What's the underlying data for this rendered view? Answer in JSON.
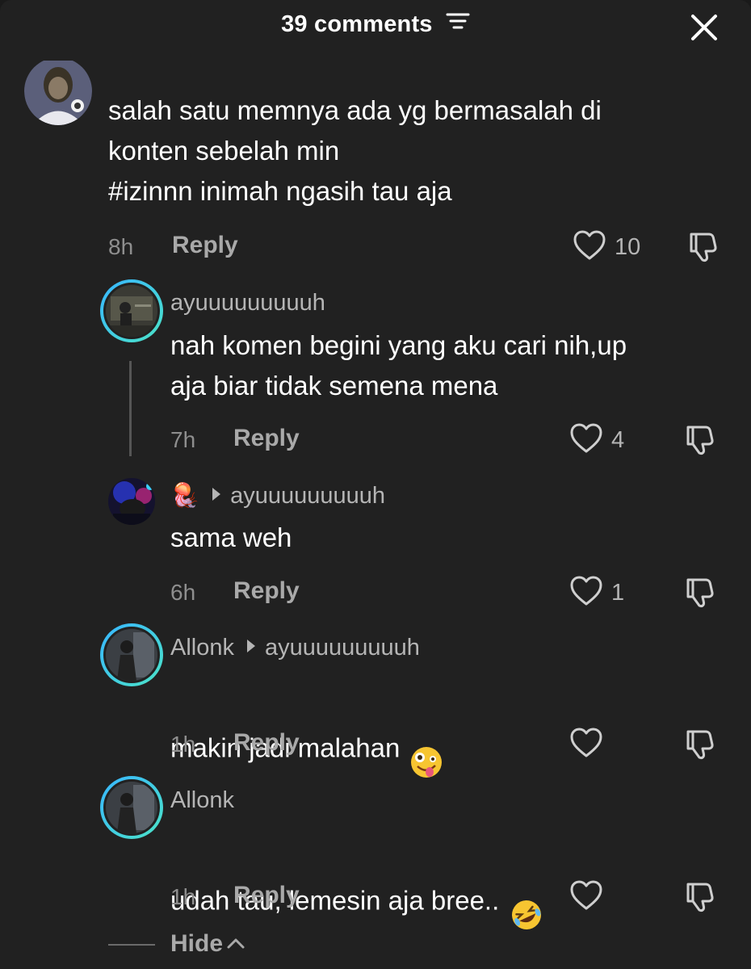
{
  "header": {
    "title": "39 comments",
    "sort_icon": "sort-lines-icon",
    "close_icon": "close-icon"
  },
  "comments": [
    {
      "username": "",
      "text": "salah satu memnya ada yg bermasalah di\nkonten sebelah min\n#izinnn inimah ngasih tau aja",
      "time": "8h",
      "reply_label": "Reply",
      "likes": "10"
    },
    {
      "username": "ayuuuuuuuuuh",
      "text": "nah komen begini yang aku cari nih,up\naja biar tidak semena mena",
      "time": "7h",
      "reply_label": "Reply",
      "likes": "4"
    },
    {
      "username": "🪼",
      "reply_to": "ayuuuuuuuuuh",
      "text": "sama weh",
      "time": "6h",
      "reply_label": "Reply",
      "likes": "1"
    },
    {
      "username": "Allonk",
      "reply_to": "ayuuuuuuuuuh",
      "text": "makin jadi malahan",
      "emoji": "zany-face-emoji",
      "time": "1h",
      "reply_label": "Reply",
      "likes": ""
    },
    {
      "username": "Allonk",
      "text": "udah tau, lemesin aja bree..",
      "emoji": "rolling-on-floor-laughing-emoji",
      "time": "1h",
      "reply_label": "Reply",
      "likes": ""
    }
  ],
  "hide_label": "Hide",
  "colors": {
    "background": "#212121",
    "ring_start": "#38b6ff",
    "ring_end": "#4be3c7",
    "muted_text": "#8e8e8e"
  }
}
